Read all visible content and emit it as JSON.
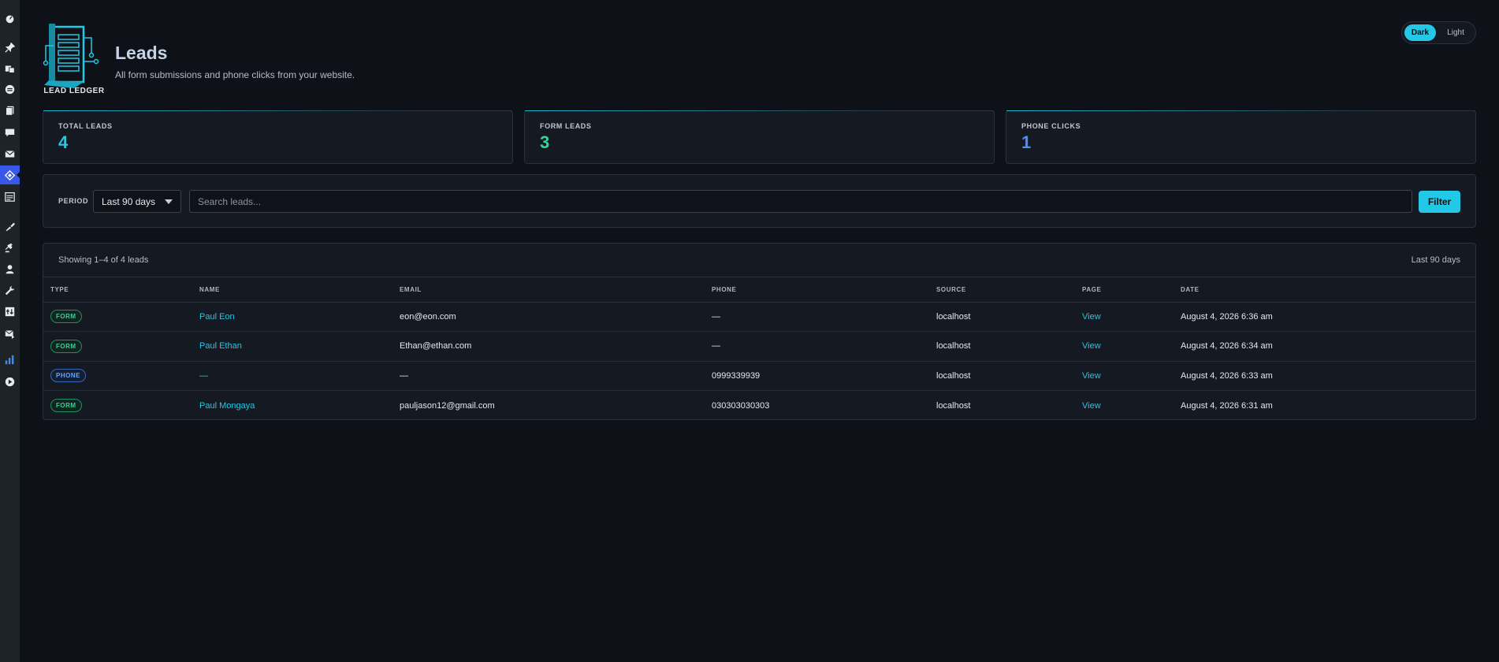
{
  "sidebar": {
    "icons": [
      "dashboard-icon",
      "pin-icon",
      "media-icon",
      "comments-icon",
      "pages-icon",
      "feedback-icon",
      "mail-icon",
      "leads-icon",
      "calendar-icon",
      "appearance-icon",
      "plugins-icon",
      "users-icon",
      "tools-icon",
      "settings-icon",
      "email-log-icon",
      "analytics-icon",
      "play-icon"
    ]
  },
  "header": {
    "logo_text": "LEAD LEDGER",
    "title": "Leads",
    "subtitle": "All form submissions and phone clicks from your website."
  },
  "theme": {
    "dark_label": "Dark",
    "light_label": "Light",
    "active": "Dark"
  },
  "stats": [
    {
      "label": "TOTAL LEADS",
      "value": "4",
      "color": "#22c8e5"
    },
    {
      "label": "FORM LEADS",
      "value": "3",
      "color": "#34d39a"
    },
    {
      "label": "PHONE CLICKS",
      "value": "1",
      "color": "#4f8ff7"
    }
  ],
  "filters": {
    "period_label": "PERIOD",
    "period_value": "Last 90 days",
    "search_placeholder": "Search leads...",
    "filter_label": "Filter"
  },
  "table": {
    "showing": "Showing 1–4 of 4 leads",
    "range": "Last 90 days",
    "columns": [
      "TYPE",
      "NAME",
      "EMAIL",
      "PHONE",
      "SOURCE",
      "PAGE",
      "DATE"
    ],
    "rows": [
      {
        "type": "FORM",
        "name": "Paul Eon",
        "email": "eon@eon.com",
        "phone": "—",
        "source": "localhost",
        "page": "View",
        "date": "August 4, 2026 6:36 am"
      },
      {
        "type": "FORM",
        "name": "Paul Ethan",
        "email": "Ethan@ethan.com",
        "phone": "—",
        "source": "localhost",
        "page": "View",
        "date": "August 4, 2026 6:34 am"
      },
      {
        "type": "PHONE",
        "name": "—",
        "email": "—",
        "phone": "0999339939",
        "source": "localhost",
        "page": "View",
        "date": "August 4, 2026 6:33 am"
      },
      {
        "type": "FORM",
        "name": "Paul Mongaya",
        "email": "pauljason12@gmail.com",
        "phone": "030303030303",
        "source": "localhost",
        "page": "View",
        "date": "August 4, 2026 6:31 am"
      }
    ]
  }
}
